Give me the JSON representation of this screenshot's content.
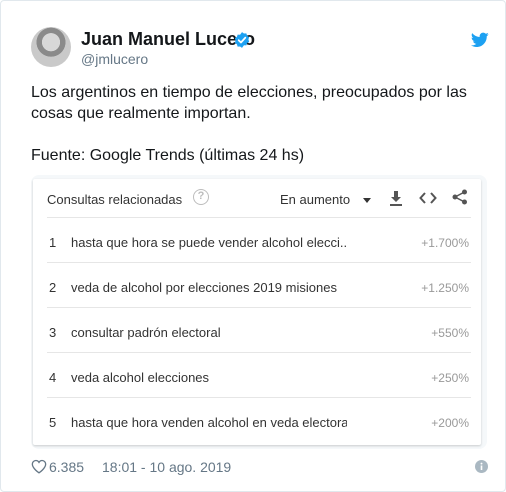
{
  "tweet": {
    "author_name": "Juan Manuel Lucero",
    "author_handle": "@jmlucero",
    "text": "Los argentinos en tiempo de elecciones, preocupados por las cosas que realmente importan.\n\nFuente: Google Trends (últimas 24 hs)",
    "likes": "6.385",
    "timestamp": "18:01 - 10 ago. 2019"
  },
  "trends": {
    "title": "Consultas relacionadas",
    "filter": "En aumento",
    "rows": [
      {
        "rank": "1",
        "query": "hasta que hora se puede vender alcohol elecci...",
        "value": "+1.700%"
      },
      {
        "rank": "2",
        "query": "veda de alcohol por elecciones 2019 misiones",
        "value": "+1.250%"
      },
      {
        "rank": "3",
        "query": "consultar padrón electoral",
        "value": "+550%"
      },
      {
        "rank": "4",
        "query": "veda alcohol elecciones",
        "value": "+250%"
      },
      {
        "rank": "5",
        "query": "hasta que hora venden alcohol en veda electoral",
        "value": "+200%"
      }
    ]
  },
  "icons": {
    "verified": "verified-badge-icon",
    "brand": "twitter-bird-icon",
    "help": "help-icon",
    "download": "download-icon",
    "embed": "embed-code-icon",
    "share": "share-icon",
    "like": "heart-icon",
    "info": "info-icon"
  },
  "colors": {
    "twitter_blue": "#1da1f2",
    "text": "#14171a",
    "muted": "#657786"
  }
}
